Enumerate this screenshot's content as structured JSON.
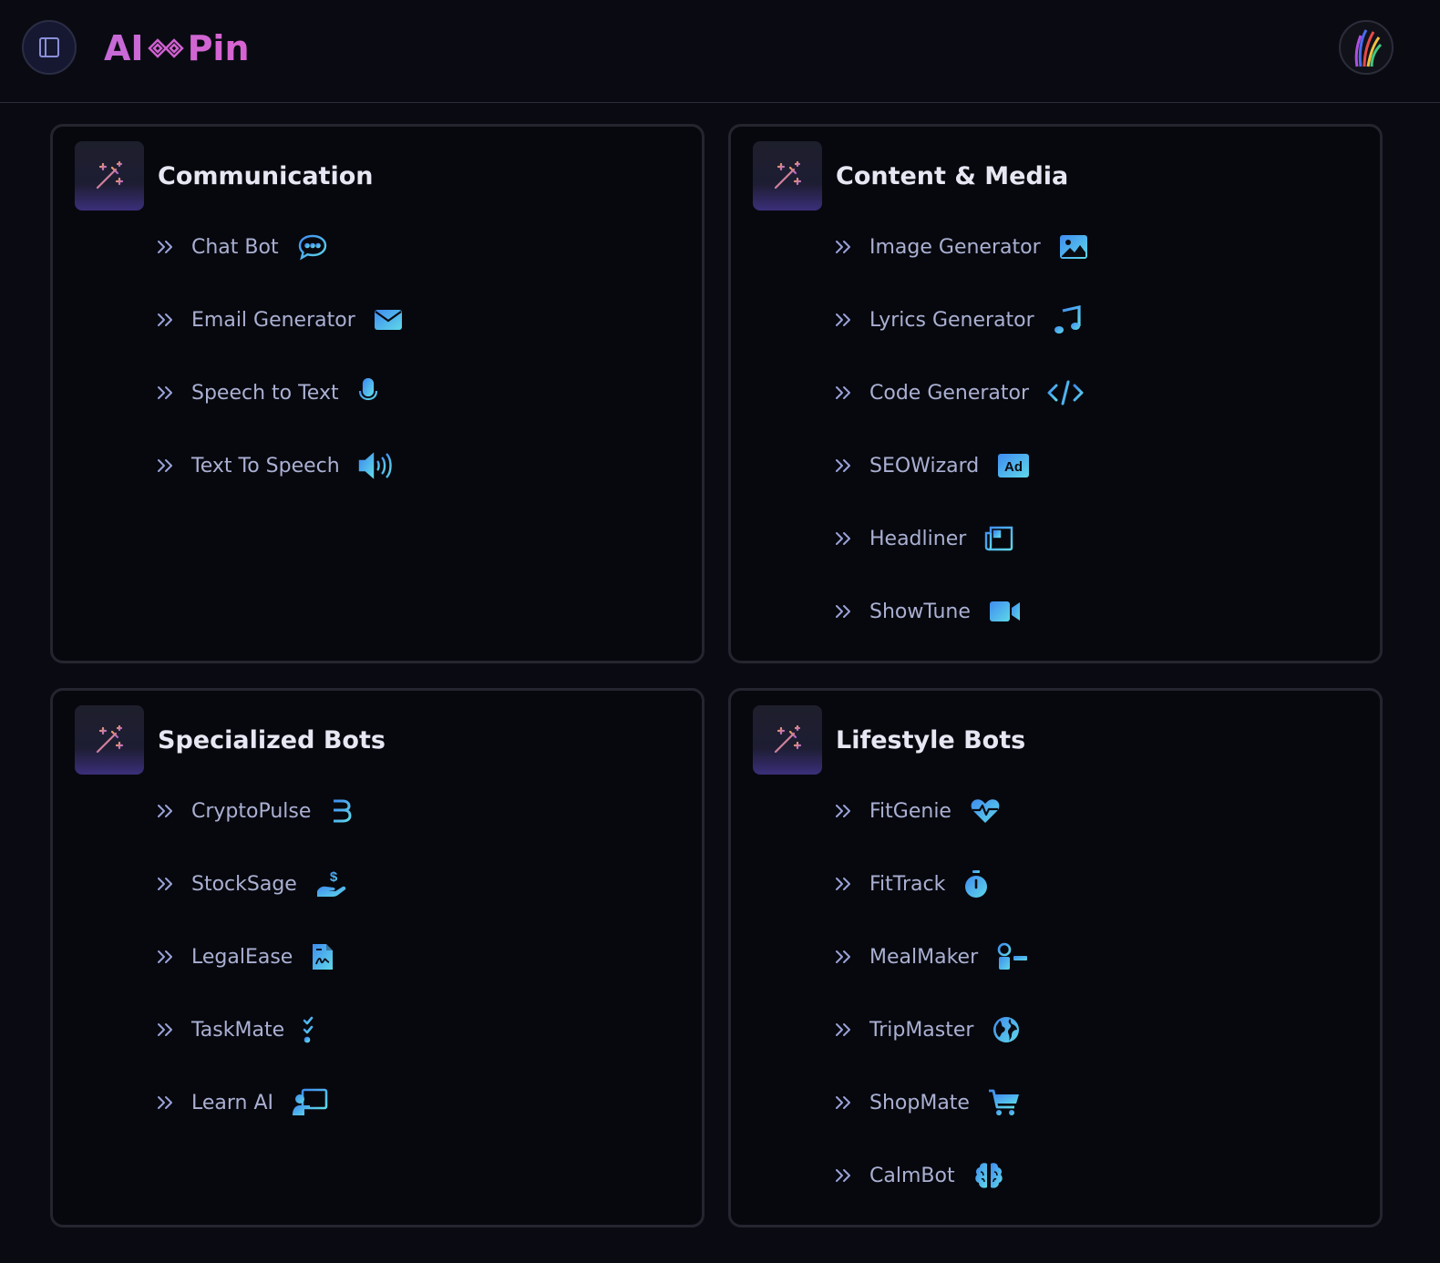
{
  "header": {
    "logo_left": "AI",
    "logo_right": "Pin",
    "sidebar_toggle_icon": "sidebar-panel-icon",
    "avatar_icon": "user-avatar"
  },
  "colors": {
    "background": "#0a0b12",
    "accent_pink": "#d863d0",
    "icon_gradient_start": "#42a5f5",
    "icon_gradient_end": "#5ce1e6",
    "item_text": "#aab0d2"
  },
  "cards": [
    {
      "title": "Communication",
      "icon": "magic-wand-icon",
      "items": [
        {
          "label": "Chat Bot",
          "icon": "chat-bubble-icon"
        },
        {
          "label": "Email Generator",
          "icon": "envelope-icon"
        },
        {
          "label": "Speech to Text",
          "icon": "microphone-icon"
        },
        {
          "label": "Text To Speech",
          "icon": "speaker-icon"
        }
      ]
    },
    {
      "title": "Content & Media",
      "icon": "magic-wand-icon",
      "items": [
        {
          "label": "Image Generator",
          "icon": "image-icon"
        },
        {
          "label": "Lyrics Generator",
          "icon": "music-note-icon"
        },
        {
          "label": "Code Generator",
          "icon": "code-icon"
        },
        {
          "label": "SEOWizard",
          "icon": "ad-badge-icon",
          "badge_text": "Ad"
        },
        {
          "label": "Headliner",
          "icon": "newspaper-icon"
        },
        {
          "label": "ShowTune",
          "icon": "video-camera-icon"
        }
      ]
    },
    {
      "title": "Specialized Bots",
      "icon": "magic-wand-icon",
      "items": [
        {
          "label": "CryptoPulse",
          "icon": "bitcoin-icon"
        },
        {
          "label": "StockSage",
          "icon": "hand-dollar-icon"
        },
        {
          "label": "LegalEase",
          "icon": "contract-icon"
        },
        {
          "label": "TaskMate",
          "icon": "checklist-icon"
        },
        {
          "label": "Learn AI",
          "icon": "teacher-icon"
        }
      ]
    },
    {
      "title": "Lifestyle Bots",
      "icon": "magic-wand-icon",
      "items": [
        {
          "label": "FitGenie",
          "icon": "heart-pulse-icon"
        },
        {
          "label": "FitTrack",
          "icon": "stopwatch-icon"
        },
        {
          "label": "MealMaker",
          "icon": "recipe-icon"
        },
        {
          "label": "TripMaster",
          "icon": "globe-icon"
        },
        {
          "label": "ShopMate",
          "icon": "cart-icon"
        },
        {
          "label": "CalmBot",
          "icon": "brain-icon"
        }
      ]
    }
  ]
}
